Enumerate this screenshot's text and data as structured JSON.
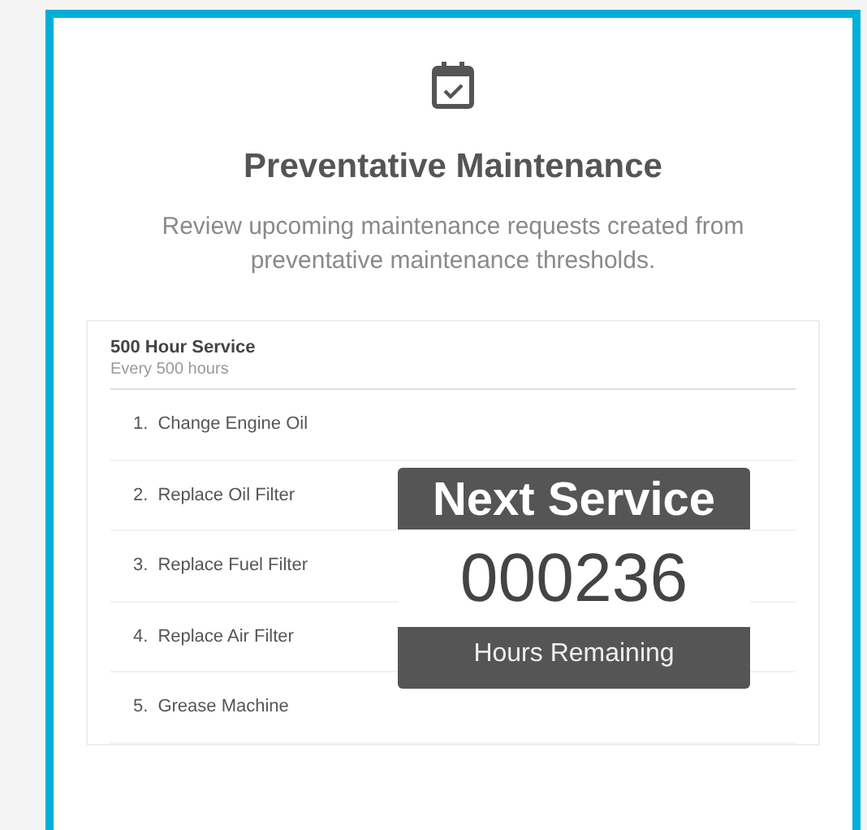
{
  "header": {
    "title": "Preventative Maintenance",
    "description": "Review upcoming maintenance requests created from preventative maintenance thresholds."
  },
  "service": {
    "name": "500 Hour Service",
    "interval": "Every 500 hours",
    "tasks": [
      {
        "number": "1.",
        "label": "Change Engine Oil"
      },
      {
        "number": "2.",
        "label": "Replace Oil Filter"
      },
      {
        "number": "3.",
        "label": "Replace Fuel Filter"
      },
      {
        "number": "4.",
        "label": "Replace Air Filter"
      },
      {
        "number": "5.",
        "label": "Grease Machine"
      }
    ]
  },
  "badge": {
    "title": "Next Service",
    "value": "000236",
    "caption": "Hours Remaining"
  }
}
